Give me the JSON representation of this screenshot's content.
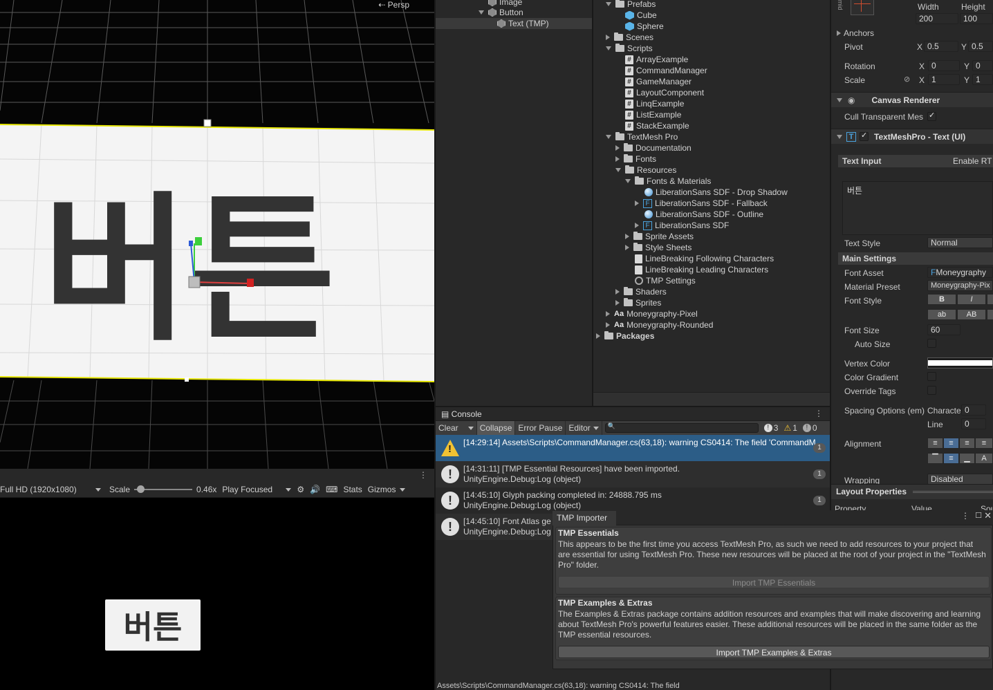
{
  "scene": {
    "projection_label": "Persp",
    "glyph_text": "버튼"
  },
  "game_toolbar": {
    "resolution": "Full HD (1920x1080)",
    "scale_label": "Scale",
    "scale_value": "0.46x",
    "play_mode": "Play Focused",
    "stats": "Stats",
    "gizmos": "Gizmos"
  },
  "game_view": {
    "button_text": "버튼"
  },
  "hierarchy": {
    "items": [
      {
        "label": "Image"
      },
      {
        "label": "Button"
      },
      {
        "label": "Text (TMP)"
      }
    ]
  },
  "project": {
    "items": [
      {
        "label": "Prefabs"
      },
      {
        "label": "Cube"
      },
      {
        "label": "Sphere"
      },
      {
        "label": "Scenes"
      },
      {
        "label": "Scripts"
      },
      {
        "label": "ArrayExample"
      },
      {
        "label": "CommandManager"
      },
      {
        "label": "GameManager"
      },
      {
        "label": "LayoutComponent"
      },
      {
        "label": "LinqExample"
      },
      {
        "label": "ListExample"
      },
      {
        "label": "StackExample"
      },
      {
        "label": "TextMesh Pro"
      },
      {
        "label": "Documentation"
      },
      {
        "label": "Fonts"
      },
      {
        "label": "Resources"
      },
      {
        "label": "Fonts & Materials"
      },
      {
        "label": "LiberationSans SDF - Drop Shadow"
      },
      {
        "label": "LiberationSans SDF - Fallback"
      },
      {
        "label": "LiberationSans SDF - Outline"
      },
      {
        "label": "LiberationSans SDF"
      },
      {
        "label": "Sprite Assets"
      },
      {
        "label": "Style Sheets"
      },
      {
        "label": "LineBreaking Following Characters"
      },
      {
        "label": "LineBreaking Leading Characters"
      },
      {
        "label": "TMP Settings"
      },
      {
        "label": "Shaders"
      },
      {
        "label": "Sprites"
      },
      {
        "label": "Moneygraphy-Pixel"
      },
      {
        "label": "Moneygraphy-Rounded"
      },
      {
        "label": "Packages"
      }
    ]
  },
  "console": {
    "tab_label": "Console",
    "toolbar": {
      "clear": "Clear",
      "collapse": "Collapse",
      "error_pause": "Error Pause",
      "editor": "Editor",
      "info_count": "3",
      "warn_count": "1",
      "error_count": "0"
    },
    "logs": [
      {
        "line1": "[14:29:14] Assets\\Scripts\\CommandManager.cs(63,18): warning CS0414: The field 'CommandManager",
        "line2": "",
        "count": "1",
        "type": "warning"
      },
      {
        "line1": "[14:31:11] [TMP Essential Resources] have been imported.",
        "line2": "UnityEngine.Debug:Log (object)",
        "count": "1",
        "type": "info"
      },
      {
        "line1": "[14:45:10] Glyph packing completed in: 24888.795 ms",
        "line2": "UnityEngine.Debug:Log (object)",
        "count": "1",
        "type": "info"
      },
      {
        "line1": "[14:45:10] Font Atlas ge",
        "line2": "UnityEngine.Debug:Log",
        "count": "",
        "type": "info"
      }
    ],
    "status": "Assets\\Scripts\\CommandManager.cs(63,18): warning CS0414: The field"
  },
  "inspector": {
    "rect": {
      "width_label": "Width",
      "height_label": "Height",
      "width": "200",
      "height": "100",
      "anchors": "Anchors",
      "pivot": "Pivot",
      "pivot_x": "0.5",
      "pivot_y": "0.5",
      "rotation": "Rotation",
      "rot_x": "0",
      "rot_y": "0",
      "scale": "Scale",
      "scale_x": "1",
      "scale_y": "1",
      "x": "X",
      "y": "Y"
    },
    "canvas_renderer": {
      "title": "Canvas Renderer",
      "cull": "Cull Transparent Mes"
    },
    "tmp": {
      "title": "TextMeshPro - Text (UI)",
      "text_input": "Text Input",
      "enable_rtl": "Enable RT",
      "text_value": "버튼",
      "text_style_label": "Text Style",
      "text_style": "Normal",
      "main_settings": "Main Settings",
      "font_asset_label": "Font Asset",
      "font_asset": "Moneygraphy",
      "material_preset_label": "Material Preset",
      "material_preset": "Moneygraphy-Pix",
      "font_style_label": "Font Style",
      "fs_b": "B",
      "fs_i": "I",
      "fs_ab": "ab",
      "fs_AB": "AB",
      "font_size_label": "Font Size",
      "font_size": "60",
      "auto_size": "Auto Size",
      "vertex_color": "Vertex Color",
      "color_gradient": "Color Gradient",
      "override_tags": "Override Tags",
      "spacing_label": "Spacing Options (em)",
      "character": "Characte",
      "spacing_char": "0",
      "line_label": "Line",
      "spacing_line": "0",
      "alignment": "Alignment",
      "wrapping_label": "Wrapping",
      "wrapping": "Disabled"
    },
    "layout_properties": "Layout Properties",
    "property_col": "Property",
    "value_col": "Value",
    "source_col": "Sou"
  },
  "tmp_importer": {
    "tab": "TMP Importer",
    "essentials_title": "TMP Essentials",
    "essentials_desc": "This appears to be the first time you access TextMesh Pro, as such we need to add resources to your project that are essential for using TextMesh Pro. These new resources will be placed at the root of your project in the \"TextMesh Pro\" folder.",
    "essentials_button": "Import TMP Essentials",
    "extras_title": "TMP Examples & Extras",
    "extras_desc": "The Examples & Extras package contains addition resources and examples that will make discovering and learning about TextMesh Pro's powerful features easier. These additional resources will be placed in the same folder as the TMP essential resources.",
    "extras_button": "Import TMP Examples & Extras"
  }
}
